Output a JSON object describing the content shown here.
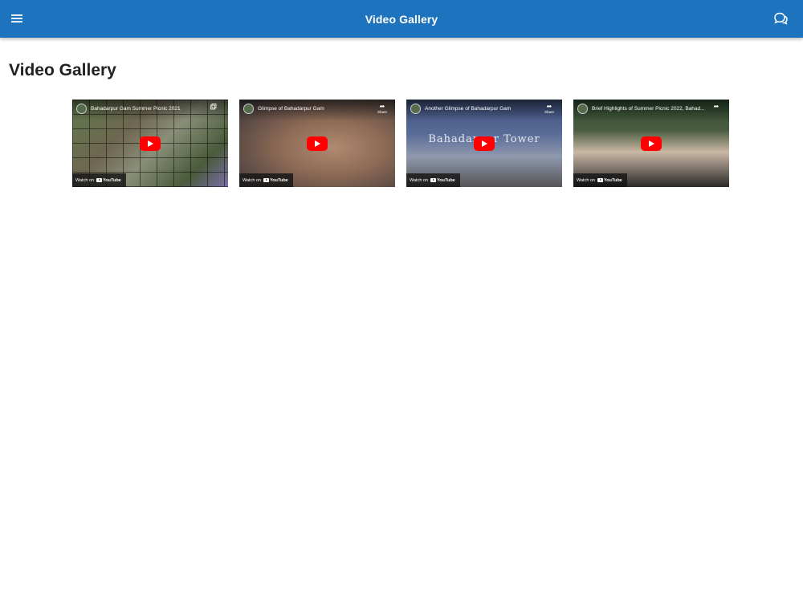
{
  "appbar": {
    "title": "Video Gallery",
    "menu_icon": "hamburger-menu-icon",
    "chat_icon": "chat-bubbles-icon",
    "background": "#1e73be"
  },
  "page": {
    "title": "Video Gallery"
  },
  "videos": [
    {
      "title": "Bahadarpur Gam Summer Picnic 2021",
      "watch_label": "Watch on",
      "brand": "YouTube",
      "share_label": ""
    },
    {
      "title": "Glimpse of Bahadarpur Gam",
      "watch_label": "Watch on",
      "brand": "YouTube",
      "share_label": "Share"
    },
    {
      "title": "Another Glimpse of Bahadarpur Gam",
      "watch_label": "Watch on",
      "brand": "YouTube",
      "share_label": "Share",
      "overlay_text": "Bahadarpur Tower"
    },
    {
      "title": "Brief Highlights of Summer Picnic 2022, Bahad...",
      "watch_label": "Watch on",
      "brand": "YouTube",
      "share_label": ""
    }
  ],
  "colors": {
    "play_button": "#ff0000"
  }
}
